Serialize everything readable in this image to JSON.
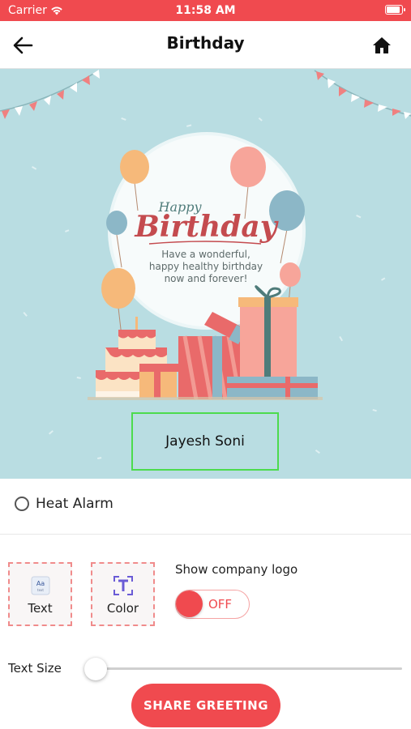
{
  "status_bar": {
    "carrier": "Carrier",
    "time": "11:58 AM",
    "battery_level": 0.95
  },
  "nav": {
    "title": "Birthday",
    "back_icon": "arrow-left-icon",
    "home_icon": "home-icon"
  },
  "card": {
    "happy": "Happy",
    "birthday": "Birthday",
    "message": [
      "Have a wonderful,",
      "happy healthy birthday",
      "now and forever!"
    ],
    "name": "Jayesh Soni",
    "colors": {
      "background": "#b9dde2",
      "accent": "#c44b4f"
    }
  },
  "options": {
    "heat_alarm": "Heat Alarm",
    "heat_alarm_checked": false
  },
  "tools": {
    "text_label": "Text",
    "color_label": "Color",
    "text_icon": "text-icon",
    "color_icon": "color-icon"
  },
  "logo": {
    "label": "Show company logo",
    "toggle_state": "OFF"
  },
  "text_size": {
    "label": "Text Size",
    "value": 0.0
  },
  "share_button": {
    "label": "SHARE GREETING"
  },
  "theme": {
    "primary": "#f04a4f",
    "dashed_border": "#f08b8b"
  }
}
